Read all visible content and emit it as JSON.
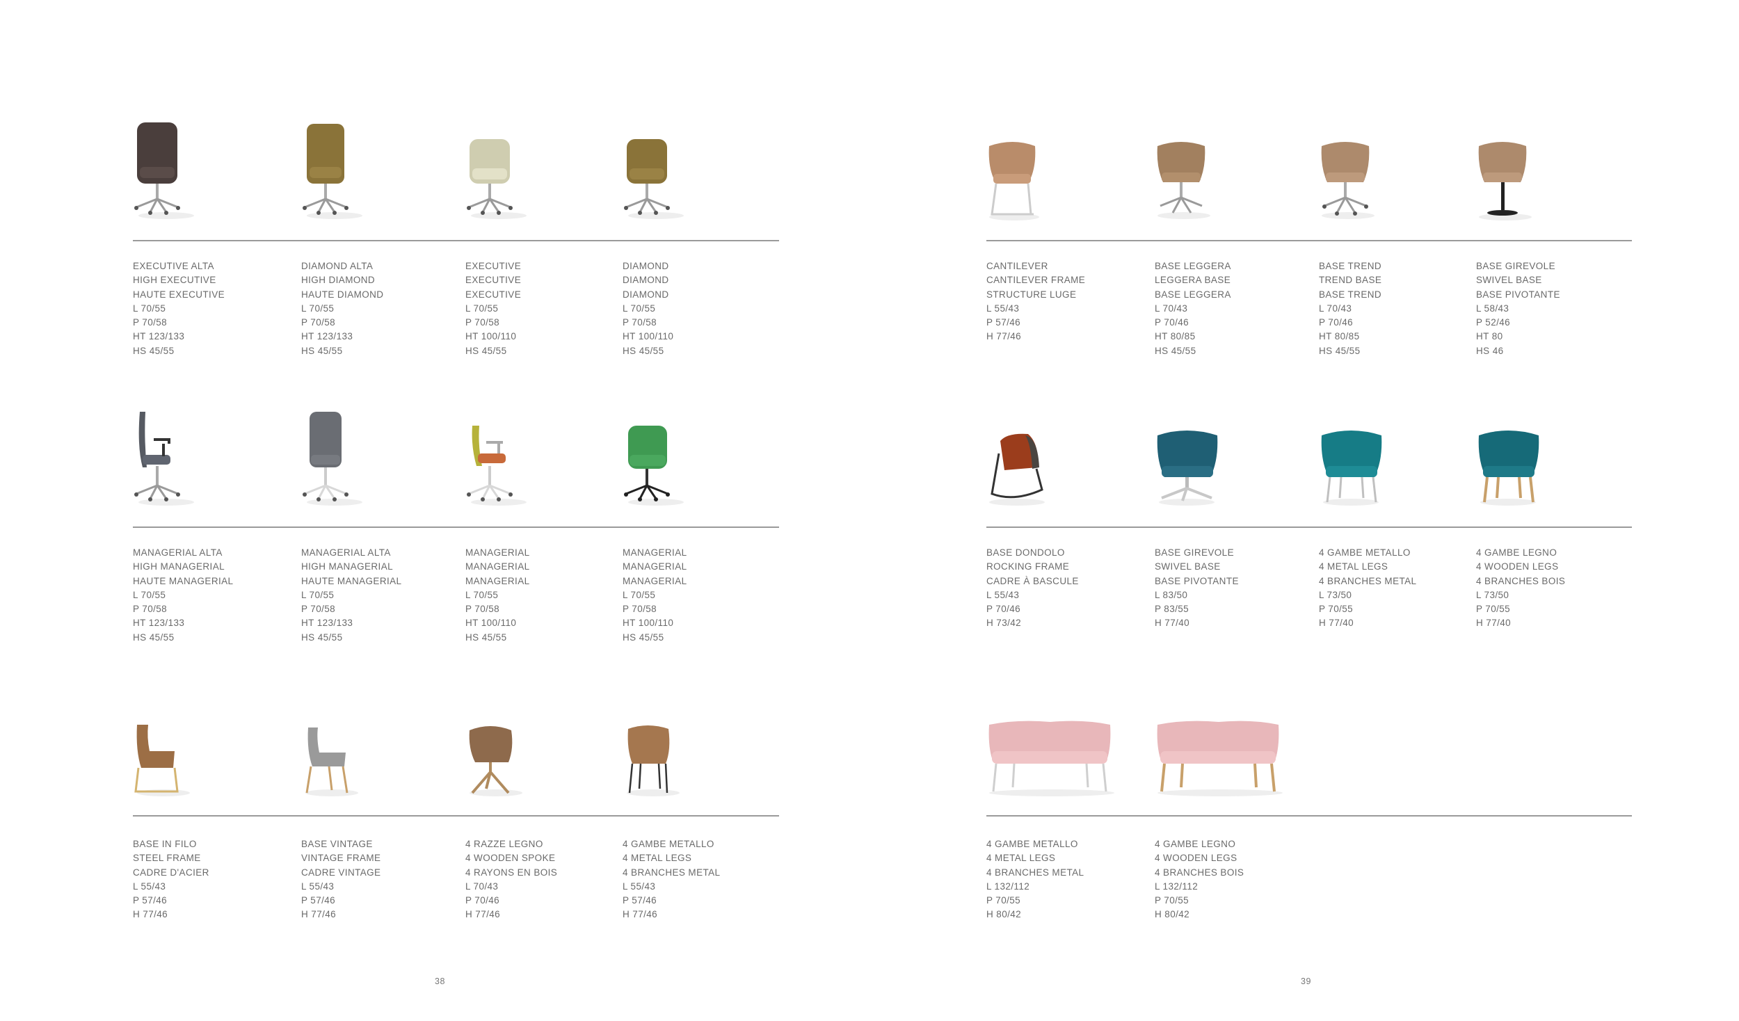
{
  "pages": [
    {
      "number": "38",
      "rows": [
        {
          "items": [
            {
              "icon": "executive-high-chair-icon",
              "color": "#4a3e3c",
              "lines": [
                "EXECUTIVE ALTA",
                "HIGH EXECUTIVE",
                "HAUTE EXECUTIVE",
                "L 70/55",
                "P 70/58",
                "HT 123/133",
                "HS 45/55"
              ]
            },
            {
              "icon": "diamond-high-chair-icon",
              "color": "#8a7339",
              "lines": [
                "DIAMOND ALTA",
                "HIGH DIAMOND",
                "HAUTE DIAMOND",
                "L 70/55",
                "P 70/58",
                "HT 123/133",
                "HS 45/55"
              ]
            },
            {
              "icon": "executive-chair-icon",
              "color": "#cfcdb0",
              "lines": [
                "EXECUTIVE",
                "EXECUTIVE",
                "EXECUTIVE",
                "L 70/55",
                "P 70/58",
                "HT 100/110",
                "HS 45/55"
              ]
            },
            {
              "icon": "diamond-chair-icon",
              "color": "#8a7339",
              "lines": [
                "DIAMOND",
                "DIAMOND",
                "DIAMOND",
                "L 70/55",
                "P 70/58",
                "HT 100/110",
                "HS 45/55"
              ]
            }
          ]
        },
        {
          "items": [
            {
              "icon": "managerial-high-armchair-icon",
              "color": "#565a62",
              "lines": [
                "MANAGERIAL ALTA",
                "HIGH MANAGERIAL",
                "HAUTE MANAGERIAL",
                "L 70/55",
                "P 70/58",
                "HT 123/133",
                "HS 45/55"
              ]
            },
            {
              "icon": "managerial-high-chair-icon",
              "color": "#6a6d73",
              "lines": [
                "MANAGERIAL ALTA",
                "HIGH MANAGERIAL",
                "HAUTE MANAGERIAL",
                "L 70/55",
                "P 70/58",
                "HT 123/133",
                "HS 45/55"
              ]
            },
            {
              "icon": "managerial-armchair-icon",
              "color": "#b6b23a",
              "lines": [
                "MANAGERIAL",
                "MANAGERIAL",
                "MANAGERIAL",
                "L 70/55",
                "P 70/58",
                "HT 100/110",
                "HS 45/55"
              ]
            },
            {
              "icon": "managerial-chair-icon",
              "color": "#3f9a52",
              "lines": [
                "MANAGERIAL",
                "MANAGERIAL",
                "MANAGERIAL",
                "L 70/55",
                "P 70/58",
                "HT 100/110",
                "HS 45/55"
              ]
            }
          ]
        },
        {
          "items": [
            {
              "icon": "steel-frame-chair-icon",
              "color": "#9c6e45",
              "lines": [
                "BASE IN FILO",
                "STEEL FRAME",
                "CADRE D'ACIER",
                "L 55/43",
                "P 57/46",
                "H 77/46"
              ]
            },
            {
              "icon": "vintage-chair-icon",
              "color": "#9a9a9a",
              "lines": [
                "BASE VINTAGE",
                "VINTAGE FRAME",
                "CADRE VINTAGE",
                "L 55/43",
                "P 57/46",
                "H 77/46"
              ]
            },
            {
              "icon": "wooden-spoke-chair-icon",
              "color": "#8e6a4c",
              "lines": [
                "4 RAZZE LEGNO",
                "4 WOODEN SPOKE",
                "4 RAYONS EN BOIS",
                "L 70/43",
                "P 70/46",
                "H 77/46"
              ]
            },
            {
              "icon": "metal-legs-chair-icon",
              "color": "#a5774f",
              "lines": [
                "4 GAMBE METALLO",
                "4 METAL LEGS",
                "4 BRANCHES METAL",
                "L 55/43",
                "P 57/46",
                "H 77/46"
              ]
            }
          ]
        }
      ]
    },
    {
      "number": "39",
      "rows": [
        {
          "items": [
            {
              "icon": "cantilever-armchair-icon",
              "color": "#b98c6a",
              "lines": [
                "CANTILEVER",
                "CANTILEVER FRAME",
                "STRUCTURE LUGE",
                "L 55/43",
                "P 57/46",
                "H 77/46"
              ]
            },
            {
              "icon": "leggera-base-armchair-icon",
              "color": "#a2805f",
              "lines": [
                "BASE LEGGERA",
                "LEGGERA BASE",
                "BASE LEGGERA",
                "L 70/43",
                "P 70/46",
                "HT 80/85",
                "HS 45/55"
              ]
            },
            {
              "icon": "trend-base-armchair-icon",
              "color": "#ad8a6c",
              "lines": [
                "BASE TREND",
                "TREND BASE",
                "BASE TREND",
                "L 70/43",
                "P 70/46",
                "HT 80/85",
                "HS 45/55"
              ]
            },
            {
              "icon": "swivel-stool-armchair-icon",
              "color": "#ad8a6c",
              "lines": [
                "BASE GIREVOLE",
                "SWIVEL BASE",
                "BASE PIVOTANTE",
                "L 58/43",
                "P 52/46",
                "HT 80",
                "HS 46"
              ]
            }
          ]
        },
        {
          "items": [
            {
              "icon": "rocking-armchair-icon",
              "color": "#9b3d1c",
              "lines": [
                "BASE DONDOLO",
                "ROCKING FRAME",
                "CADRE À BASCULE",
                "L 55/43",
                "P 70/46",
                "H 73/42"
              ]
            },
            {
              "icon": "swivel-lounge-armchair-icon",
              "color": "#1f5f74",
              "lines": [
                "BASE GIREVOLE",
                "SWIVEL BASE",
                "BASE PIVOTANTE",
                "L 83/50",
                "P 83/55",
                "H 77/40"
              ]
            },
            {
              "icon": "metal-legs-lounge-armchair-icon",
              "color": "#167c86",
              "lines": [
                "4 GAMBE METALLO",
                "4 METAL LEGS",
                "4 BRANCHES METAL",
                "L 73/50",
                "P 70/55",
                "H 77/40"
              ]
            },
            {
              "icon": "wooden-legs-lounge-armchair-icon",
              "color": "#166a78",
              "lines": [
                "4 GAMBE LEGNO",
                "4 WOODEN LEGS",
                "4 BRANCHES BOIS",
                "L 73/50",
                "P 70/55",
                "H 77/40"
              ]
            }
          ]
        },
        {
          "items": [
            {
              "icon": "metal-legs-sofa-icon",
              "color": "#e8b7ba",
              "lines": [
                "4 GAMBE METALLO",
                "4 METAL LEGS",
                "4 BRANCHES METAL",
                "L 132/112",
                "P 70/55",
                "H 80/42"
              ]
            },
            {
              "icon": "wooden-legs-sofa-icon",
              "color": "#e8b7ba",
              "lines": [
                "4 GAMBE LEGNO",
                "4 WOODEN LEGS",
                "4 BRANCHES BOIS",
                "L 132/112",
                "P 70/55",
                "H 80/42"
              ]
            }
          ]
        }
      ]
    }
  ]
}
